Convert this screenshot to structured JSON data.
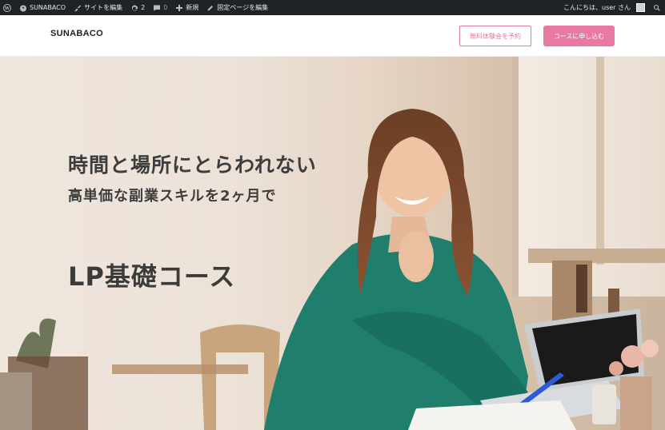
{
  "adminbar": {
    "site_name": "SUNABACO",
    "customize": "サイトを編集",
    "updates_count": "2",
    "comments_count": "0",
    "new_label": "新規",
    "edit_page": "固定ページを編集",
    "greeting": "こんにちは、user さん"
  },
  "header": {
    "logo": "SUNABACO",
    "btn_trial": "無料体験会を予約",
    "btn_apply": "コースに申し込む",
    "accent": "#e879a2"
  },
  "hero": {
    "line1": "時間と場所にとらわれない",
    "line2": "高単価な副業スキルを2ヶ月で",
    "title": "LP基礎コース"
  }
}
